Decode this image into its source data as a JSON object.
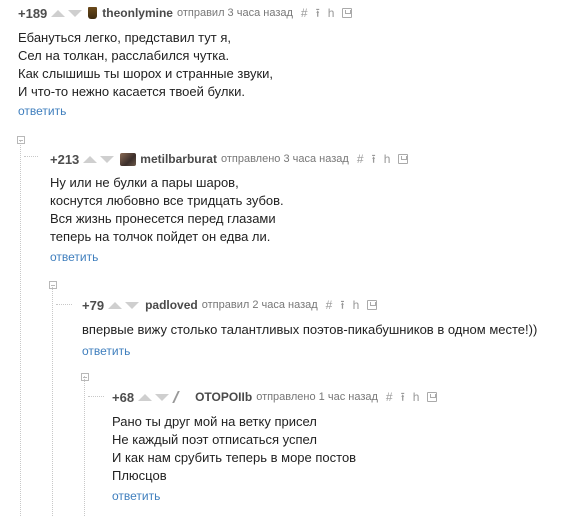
{
  "comments": [
    {
      "rating": "+189",
      "username": "theonlymine",
      "posted": "отправил 3 часа назад",
      "lines": [
        "Ебануться легко, представил тут я,",
        "Сел на толкан, расслабился чутка.",
        "Как слышишь ты шорох и странные звуки,",
        "И что-то нежно касается твоей булки."
      ],
      "reply": "ответить"
    },
    {
      "rating": "+213",
      "username": "metilbarburat",
      "posted": "отправлено 3 часа назад",
      "lines": [
        "Ну или не булки а пары шаров,",
        "коснутся любовно все тридцать зубов.",
        "Вся жизнь пронесется перед глазами",
        "теперь на толчок пойдет он едва ли."
      ],
      "reply": "ответить"
    },
    {
      "rating": "+79",
      "username": "padloved",
      "posted": "отправил 2 часа назад",
      "lines": [
        "впервые вижу столько талантливых поэтов-пикабушников в одном месте!))"
      ],
      "reply": "ответить"
    },
    {
      "rating": "+68",
      "username": "OTOPOIIb",
      "posted": "отправлено 1 час назад",
      "lines": [
        "Рано ты друг мой на ветку присел",
        "Не каждый поэт отписаться успел",
        "И как нам срубить теперь в море постов",
        "Плюсцов"
      ],
      "reply": "ответить"
    }
  ],
  "icons": {
    "hash": "#",
    "parent": "⭱",
    "branch": "h"
  },
  "colors": {
    "link": "#3e7ebd",
    "rating": "#4d4d4d",
    "meta": "#777777",
    "vote": "#cfcfcf"
  }
}
